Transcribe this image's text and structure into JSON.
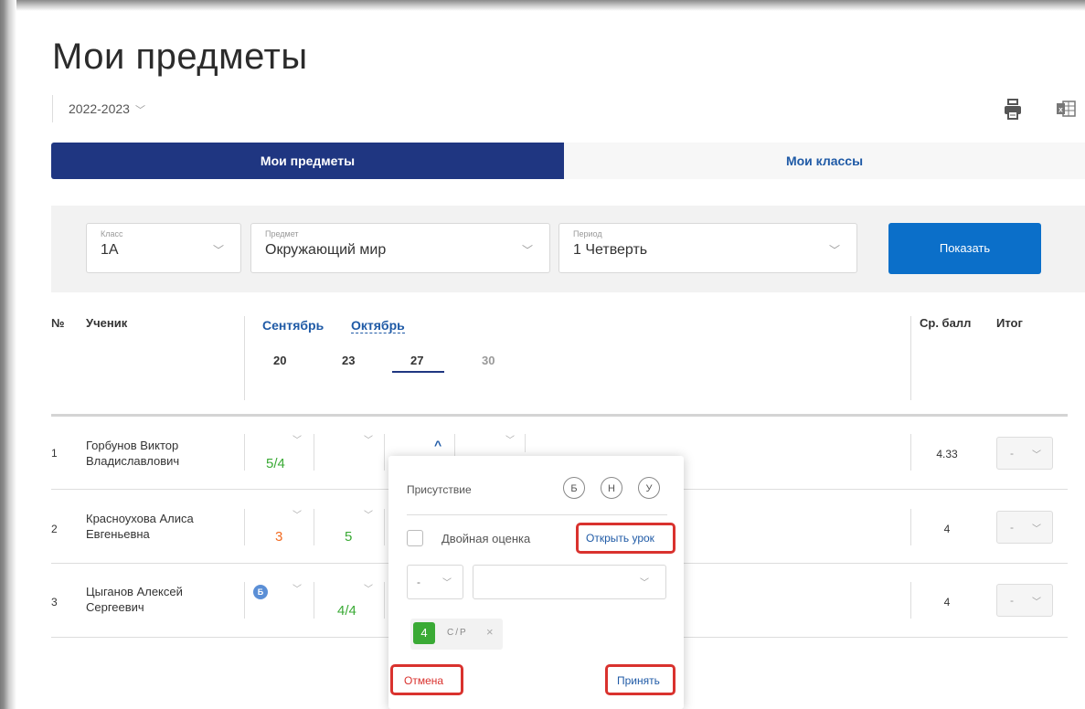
{
  "page": {
    "title": "Мои предметы",
    "year": "2022-2023"
  },
  "icons": {
    "print": "printer-icon",
    "export": "excel-icon",
    "year_chevron": "chevron-down-icon"
  },
  "tabs": [
    {
      "label": "Мои предметы",
      "active": true
    },
    {
      "label": "Мои классы",
      "active": false
    }
  ],
  "filters": {
    "class": {
      "label": "Класс",
      "value": "1А"
    },
    "subject": {
      "label": "Предмет",
      "value": "Окружающий мир"
    },
    "period": {
      "label": "Период",
      "value": "1 Четверть"
    },
    "show_button": "Показать"
  },
  "table": {
    "headers": {
      "num": "№",
      "student": "Ученик",
      "avg": "Ср. балл",
      "final": "Итог"
    },
    "months": [
      "Сентябрь",
      "Октябрь"
    ],
    "active_month": "Октябрь",
    "days": [
      "20",
      "23",
      "27",
      "30"
    ],
    "selected_day": "27",
    "rows": [
      {
        "num": "1",
        "name_line1": "Горбунов Виктор",
        "name_line2": "Владиславлович",
        "grades": [
          "5/4",
          "",
          "",
          ""
        ],
        "avg": "4.33",
        "final": "-"
      },
      {
        "num": "2",
        "name_line1": "Красноухова Алиса",
        "name_line2": "Евгеньевна",
        "grades": [
          "3",
          "5",
          "",
          ""
        ],
        "avg": "4",
        "final": "-"
      },
      {
        "num": "3",
        "name_line1": "Цыганов Алексей",
        "name_line2": "Сергеевич",
        "badge": "Б",
        "grades": [
          "",
          "4/4",
          "",
          ""
        ],
        "avg": "4",
        "final": "-"
      }
    ]
  },
  "popup": {
    "attendance_label": "Присутствие",
    "attendance_options": [
      "Б",
      "Н",
      "У"
    ],
    "double_mark_label": "Двойная оценка",
    "open_lesson": "Открыть урок",
    "mark_select_value": "-",
    "work_type_value": "",
    "mark": "4",
    "mark_type": "С/Р",
    "remove": "×",
    "cancel": "Отмена",
    "accept": "Принять"
  },
  "colors": {
    "primary": "#1f3681",
    "button": "#0b6fc9",
    "green": "#3aaa35",
    "orange": "#f26b21",
    "highlight": "#d9322e"
  }
}
